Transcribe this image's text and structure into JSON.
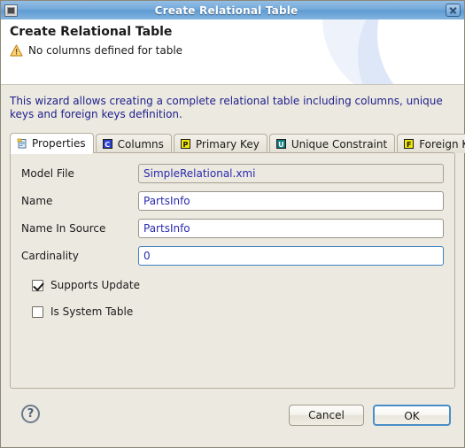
{
  "window": {
    "title": "Create Relational Table",
    "window_icon": "window-icon",
    "close_label": "close-icon"
  },
  "header": {
    "title": "Create Relational Table",
    "message": "No columns defined for table",
    "message_icon": "warning-icon"
  },
  "body": {
    "description": "This wizard allows creating a complete relational table including columns, unique keys and foreign keys definition."
  },
  "tabs": [
    {
      "label": "Properties",
      "icon": "properties-icon",
      "icon_letter": "",
      "icon_style": "props",
      "selected": true
    },
    {
      "label": "Columns",
      "icon": "columns-icon",
      "icon_letter": "C",
      "icon_style": "blue",
      "selected": false
    },
    {
      "label": "Primary Key",
      "icon": "primary-key-icon",
      "icon_letter": "P",
      "icon_style": "yellow",
      "selected": false
    },
    {
      "label": "Unique Constraint",
      "icon": "unique-constraint-icon",
      "icon_letter": "U",
      "icon_style": "teal",
      "selected": false
    },
    {
      "label": "Foreign Keys",
      "icon": "foreign-keys-icon",
      "icon_letter": "F",
      "icon_style": "yellow",
      "selected": false
    }
  ],
  "form": {
    "fields": [
      {
        "label": "Model File",
        "value": "SimpleRelational.xmi",
        "readonly": true,
        "focused": false
      },
      {
        "label": "Name",
        "value": "PartsInfo",
        "readonly": false,
        "focused": false
      },
      {
        "label": "Name In Source",
        "value": "PartsInfo",
        "readonly": false,
        "focused": false
      },
      {
        "label": "Cardinality",
        "value": "0",
        "readonly": false,
        "focused": true
      }
    ],
    "checkboxes": [
      {
        "label": "Supports Update",
        "checked": true
      },
      {
        "label": "Is System Table",
        "checked": false
      }
    ]
  },
  "footer": {
    "help_label": "?",
    "cancel_label": "Cancel",
    "ok_label": "OK"
  },
  "colors": {
    "titlebar_accent": "#5e9bd3",
    "description_text": "#1f218c",
    "field_text": "#2a2ab0",
    "focus_border": "#3c7fc4",
    "window_bg": "#ece9e0",
    "warning": "#f0b41e"
  }
}
